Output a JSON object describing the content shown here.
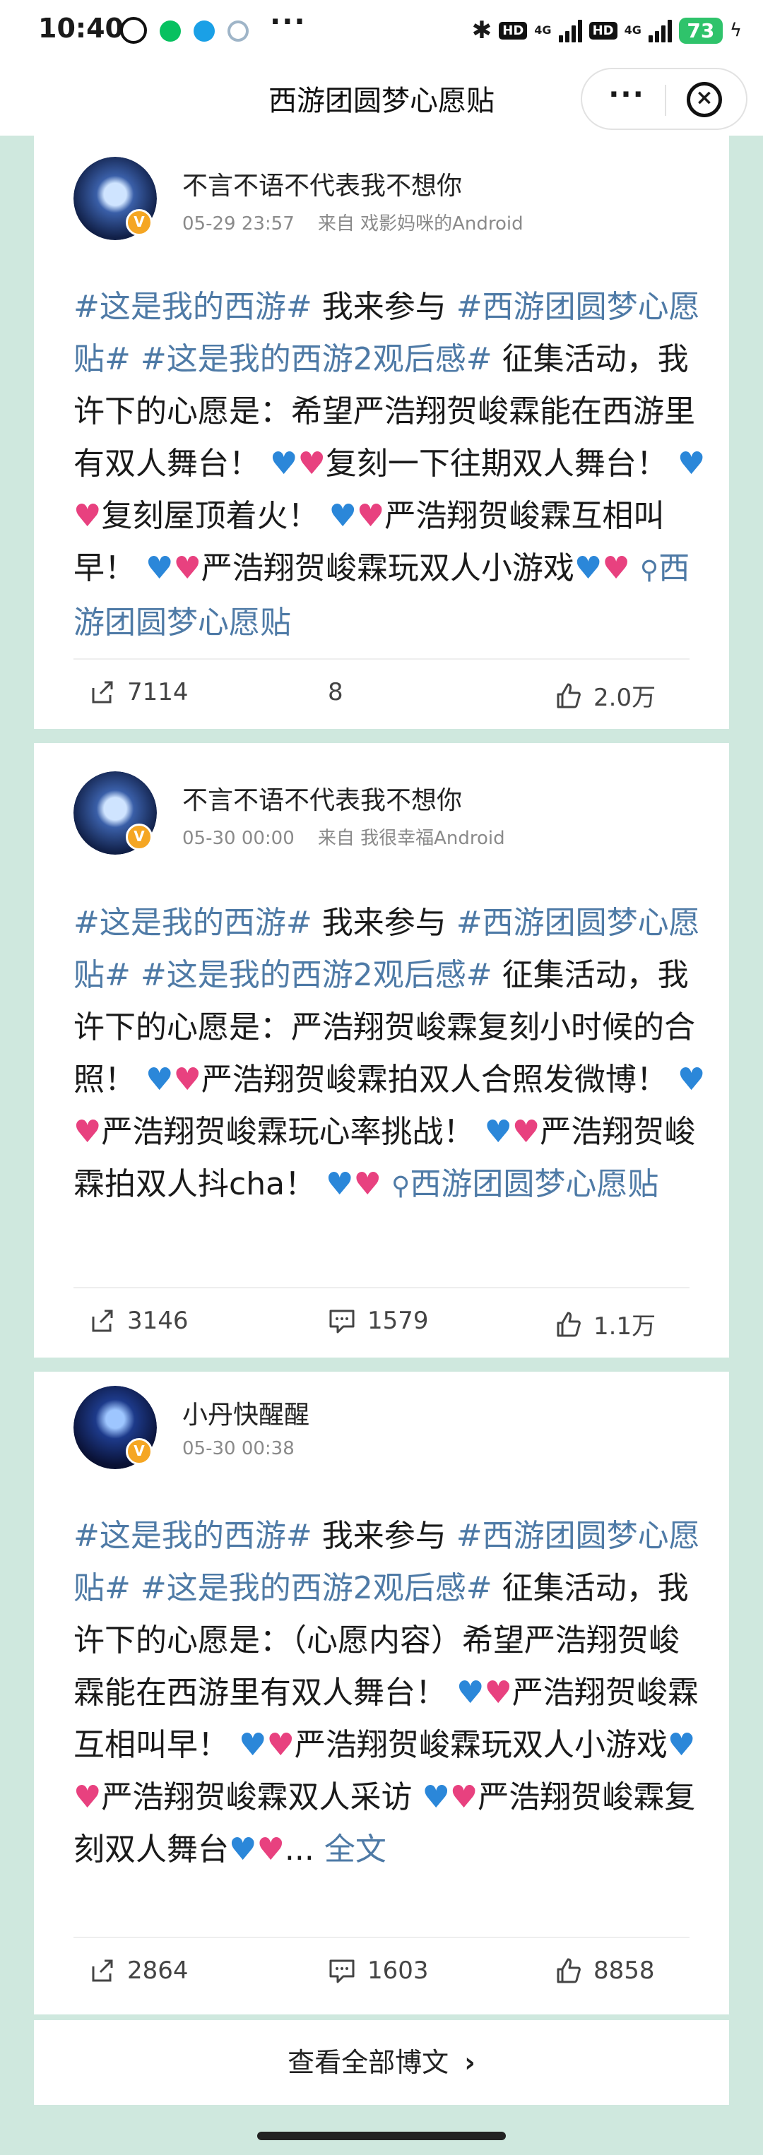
{
  "status": {
    "time": "10:40",
    "hd1": "HD",
    "net1": "4G",
    "hd2": "HD",
    "net2": "4G",
    "battery": "73"
  },
  "nav": {
    "title": "西游团圆梦心愿贴",
    "more": "···",
    "close": "×"
  },
  "posts": [
    {
      "username": "不言不语不代表我不想你",
      "time": "05-29 23:57",
      "source": "来自 戏影妈咪的Android",
      "tag1": "#这是我的西游#",
      "t1": " 我来参与 ",
      "tag2": "#西游团圆梦心愿贴#",
      "t2": " ",
      "tag3": "#这是我的西游2观后感#",
      "t3": " 征集活动，我许下的心愿是：希望严浩翔贺峻霖能在西游里有双人舞台！",
      "t4": "复刻一下往期双人舞台！",
      "t5": "复刻屋顶着火！",
      "t6": "严浩翔贺峻霖互相叫早！",
      "t7": "严浩翔贺峻霖玩双人小游戏",
      "link": "西游团圆梦心愿贴",
      "share": "7114",
      "comments": "8",
      "likes": "2.0万"
    },
    {
      "username": "不言不语不代表我不想你",
      "time": "05-30 00:00",
      "source": "来自 我很幸福Android",
      "tag1": "#这是我的西游#",
      "t1": " 我来参与 ",
      "tag2": "#西游团圆梦心愿贴#",
      "t2": " ",
      "tag3": "#这是我的西游2观后感#",
      "t3": " 征集活动，我许下的心愿是：严浩翔贺峻霖复刻小时候的合照！",
      "t4": "严浩翔贺峻霖拍双人合照发微博！",
      "t5": "严浩翔贺峻霖玩心率挑战！",
      "t6": "严浩翔贺峻霖拍双人抖cha！",
      "link": "西游团圆梦心愿贴",
      "share": "3146",
      "comments": "1579",
      "likes": "1.1万"
    },
    {
      "username": "小丹快醒醒",
      "time": "05-30 00:38",
      "tag1": "#这是我的西游#",
      "t1": " 我来参与 ",
      "tag2": "#西游团圆梦心愿贴#",
      "t2": " ",
      "tag3": "#这是我的西游2观后感#",
      "t3": " 征集活动，我许下的心愿是：（心愿内容）希望严浩翔贺峻霖能在西游里有双人舞台！",
      "t4": "严浩翔贺峻霖互相叫早！",
      "t5": "严浩翔贺峻霖玩双人小游戏",
      "t6": "严浩翔贺峻霖双人采访",
      "t7": "严浩翔贺峻霖复刻双人舞台",
      "ellipsis": "...",
      "full": "全文",
      "share": "2864",
      "comments": "1603",
      "likes": "8858"
    }
  ],
  "view_all": "查看全部博文",
  "view_all_arrow": "›",
  "colors": {
    "background": "#cfe8de",
    "tag": "#4e7aa6",
    "verified": "#f5a623",
    "battery": "#2fc36b"
  }
}
